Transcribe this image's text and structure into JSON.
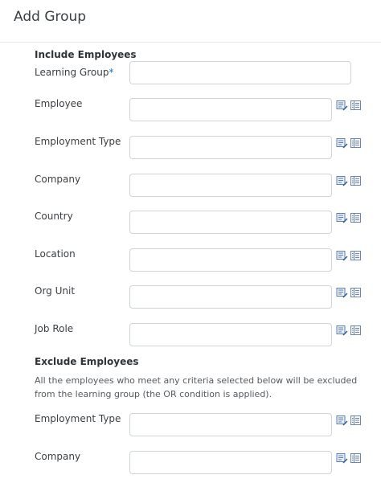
{
  "page": {
    "title": "Add Group"
  },
  "include": {
    "heading": "Include Employees",
    "learning_group": {
      "label": "Learning Group",
      "required_mark": "*",
      "value": ""
    },
    "rows": [
      {
        "label": "Employee",
        "value": ""
      },
      {
        "label": "Employment Type",
        "value": ""
      },
      {
        "label": "Company",
        "value": ""
      },
      {
        "label": "Country",
        "value": ""
      },
      {
        "label": "Location",
        "value": ""
      },
      {
        "label": "Org Unit",
        "value": ""
      },
      {
        "label": "Job Role",
        "value": ""
      }
    ]
  },
  "exclude": {
    "heading": "Exclude Employees",
    "description": "All the employees who meet any criteria selected below will be excluded from the learning group (the OR condition is applied).",
    "rows": [
      {
        "label": "Employment Type",
        "value": ""
      },
      {
        "label": "Company",
        "value": ""
      }
    ]
  },
  "icons": {
    "edit": "edit-list-icon",
    "browse": "browse-grid-icon"
  }
}
